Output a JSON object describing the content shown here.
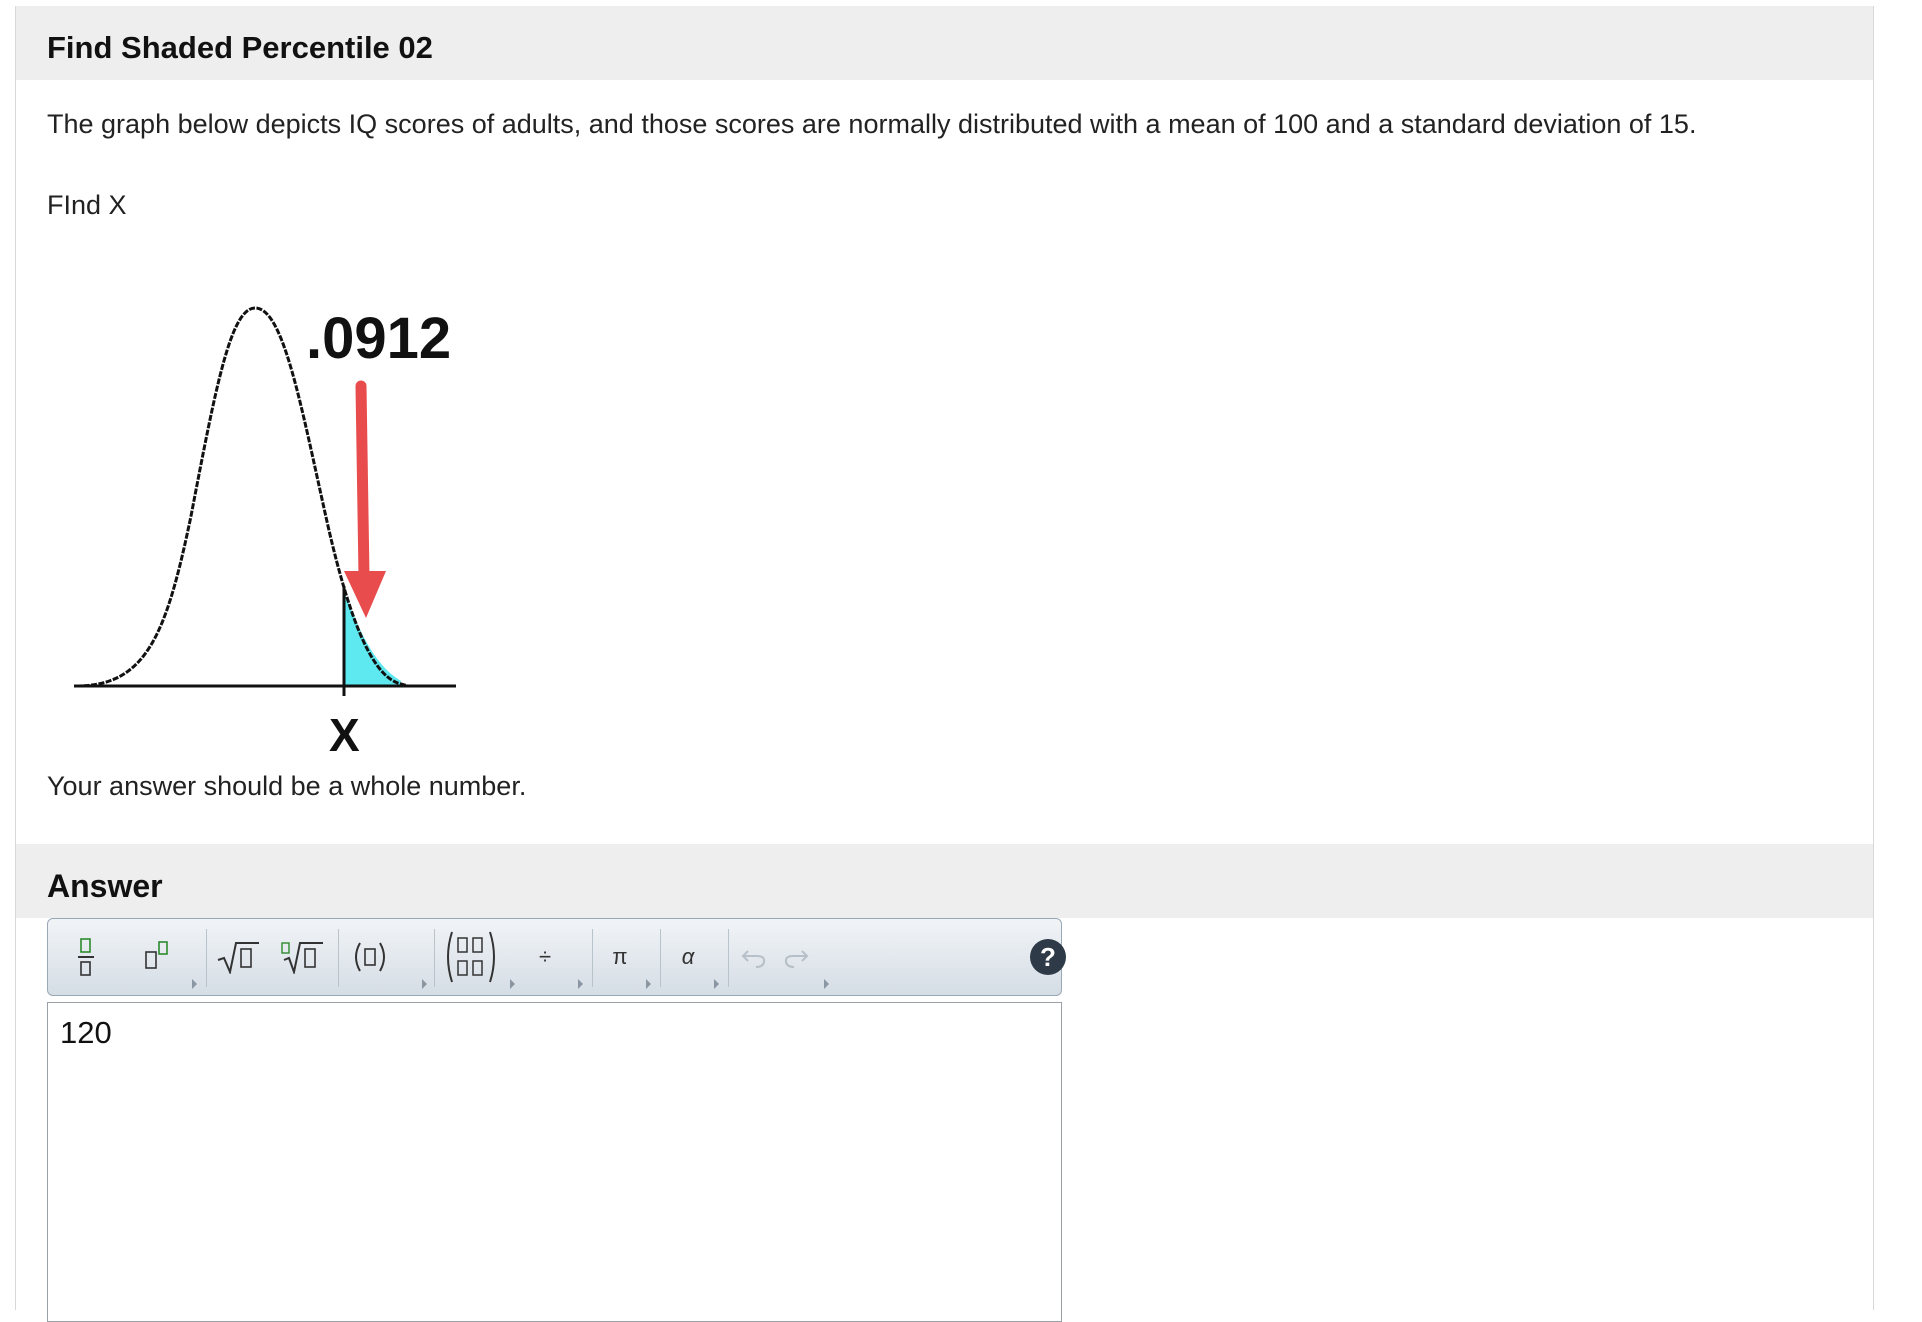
{
  "header": {
    "title": "Find Shaded Percentile 02"
  },
  "question": {
    "text": "The graph below depicts IQ scores of adults, and those scores are normally distributed with a mean of 100 and a standard deviation of 15.",
    "prompt": "FInd X",
    "hint": "Your answer should be a whole number."
  },
  "figure": {
    "shaded_area_label": ".0912",
    "x_label": "X",
    "curve_color": "#111111",
    "shade_color": "#5ee8f0",
    "arrow_color": "#e84c4c"
  },
  "answer": {
    "section_label": "Answer",
    "value": "120"
  },
  "toolbar": {
    "buttons": [
      {
        "icon": "fraction-icon"
      },
      {
        "icon": "superscript-icon"
      },
      {
        "icon": "square-root-icon"
      },
      {
        "icon": "nth-root-icon"
      },
      {
        "icon": "parentheses-icon"
      },
      {
        "icon": "matrix-icon"
      },
      {
        "icon": "divide-icon",
        "label": "÷"
      },
      {
        "icon": "pi-icon",
        "label": "π"
      },
      {
        "icon": "alpha-icon",
        "label": "α"
      },
      {
        "icon": "undo-icon"
      },
      {
        "icon": "redo-icon"
      },
      {
        "icon": "help-icon",
        "label": "?"
      }
    ]
  }
}
